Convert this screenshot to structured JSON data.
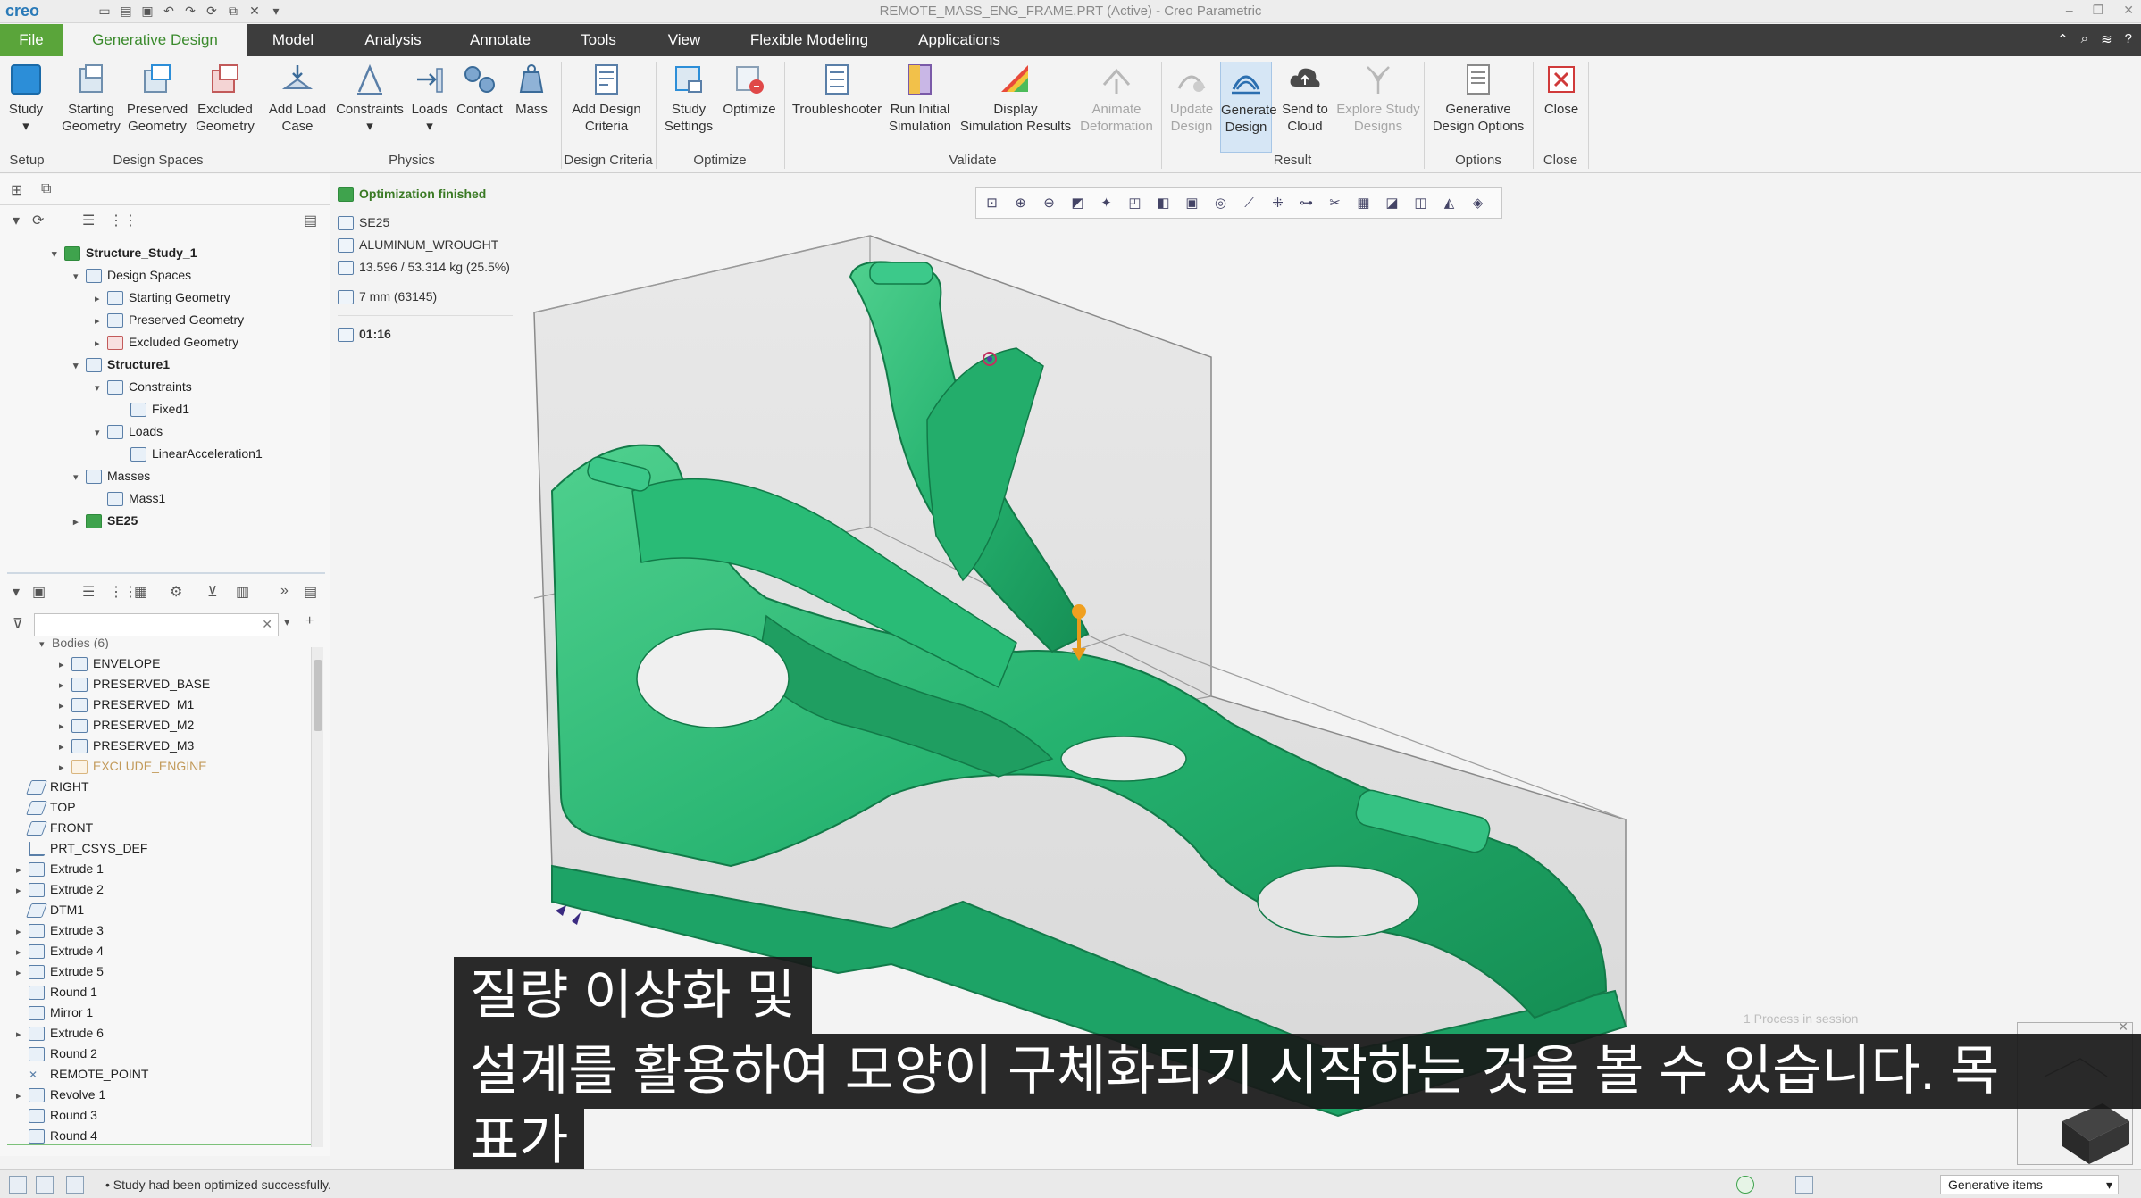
{
  "window": {
    "app_logo": "creo",
    "title": "REMOTE_MASS_ENG_FRAME.PRT (Active) - Creo Parametric"
  },
  "tabs": [
    "File",
    "Generative Design",
    "Model",
    "Analysis",
    "Annotate",
    "Tools",
    "View",
    "Flexible Modeling",
    "Applications"
  ],
  "active_tab": "Generative Design",
  "ribbon": {
    "buttons": {
      "study": "Study",
      "starting_geometry": "Starting\nGeometry",
      "preserved_geometry": "Preserved\nGeometry",
      "excluded_geometry": "Excluded\nGeometry",
      "add_load_case": "Add Load\nCase",
      "constraints": "Constraints",
      "loads": "Loads",
      "contact": "Contact",
      "mass": "Mass",
      "add_design_criteria": "Add Design\nCriteria",
      "study_settings": "Study\nSettings",
      "optimize": "Optimize",
      "troubleshooter": "Troubleshooter",
      "run_initial_simulation": "Run Initial\nSimulation",
      "display_simulation_results": "Display\nSimulation Results",
      "animate_deformation": "Animate\nDeformation",
      "update_design": "Update\nDesign",
      "generate_design": "Generate\nDesign",
      "send_to_cloud": "Send to\nCloud",
      "explore_study_designs": "Explore Study\nDesigns",
      "generative_design_options": "Generative\nDesign Options",
      "close": "Close"
    },
    "groups": {
      "setup": "Setup",
      "design_spaces": "Design Spaces",
      "physics": "Physics",
      "design_criteria": "Design Criteria",
      "optimize": "Optimize",
      "validate": "Validate",
      "result": "Result",
      "options": "Options",
      "close": "Close"
    }
  },
  "study_tree": [
    {
      "label": "Structure_Study_1",
      "bold": true
    },
    {
      "label": "Design Spaces"
    },
    {
      "label": "Starting Geometry"
    },
    {
      "label": "Preserved Geometry"
    },
    {
      "label": "Excluded Geometry"
    },
    {
      "label": "Structure1",
      "bold": true
    },
    {
      "label": "Constraints"
    },
    {
      "label": "Fixed1"
    },
    {
      "label": "Loads"
    },
    {
      "label": "LinearAcceleration1"
    },
    {
      "label": "Masses"
    },
    {
      "label": "Mass1"
    },
    {
      "label": "SE25",
      "bold": true
    }
  ],
  "model_tree": [
    {
      "label": "Bodies (6)"
    },
    {
      "label": "ENVELOPE"
    },
    {
      "label": "PRESERVED_BASE"
    },
    {
      "label": "PRESERVED_M1"
    },
    {
      "label": "PRESERVED_M2"
    },
    {
      "label": "PRESERVED_M3"
    },
    {
      "label": "EXCLUDE_ENGINE",
      "dim": true
    },
    {
      "label": "RIGHT"
    },
    {
      "label": "TOP"
    },
    {
      "label": "FRONT"
    },
    {
      "label": "PRT_CSYS_DEF"
    },
    {
      "label": "Extrude 1"
    },
    {
      "label": "Extrude 2"
    },
    {
      "label": "DTM1"
    },
    {
      "label": "Extrude 3"
    },
    {
      "label": "Extrude 4"
    },
    {
      "label": "Extrude 5"
    },
    {
      "label": "Round 1"
    },
    {
      "label": "Mirror 1"
    },
    {
      "label": "Extrude 6"
    },
    {
      "label": "Round 2"
    },
    {
      "label": "REMOTE_POINT"
    },
    {
      "label": "Revolve 1"
    },
    {
      "label": "Round 3"
    },
    {
      "label": "Round 4"
    }
  ],
  "status": {
    "headline": "Optimization finished",
    "design": "SE25",
    "material": "ALUMINUM_WROUGHT",
    "mass": "13.596 / 53.314 kg (25.5%)",
    "mesh": "7 mm (63145)",
    "time": "01:16"
  },
  "subtitle": {
    "line1": "질량 이상화 및",
    "line2": "설계를 활용하여 모양이 구체화되기 시작하는 것을 볼 수 있습니다. 목",
    "line3": "표가"
  },
  "process_message": "1 Process in session",
  "statusbar": {
    "message": "• Study had been optimized successfully.",
    "filter_value": "Generative items"
  },
  "colors": {
    "accent_green": "#5aa53a",
    "model_green": "#2fb574",
    "tab_bar": "#3d3d3d"
  }
}
